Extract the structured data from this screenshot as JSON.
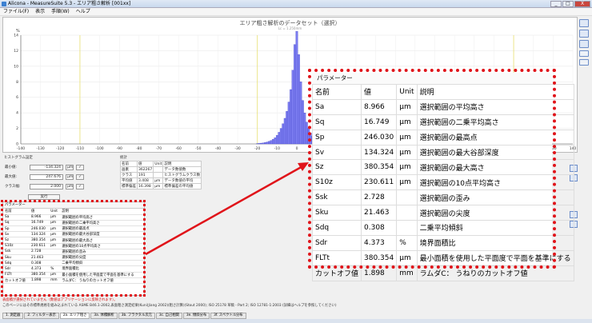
{
  "window": {
    "title": "Alicona - MeasureSuite 5.3 - エリア粗さ解析 [001xx]",
    "controls": [
      "_",
      "□",
      "X"
    ]
  },
  "menu": [
    "ファイル(F)",
    "表示",
    "手順(W)",
    "ヘルプ"
  ],
  "chart": {
    "title": "エリア粗さ解析のデータセット（選択）",
    "subtitle": "Lc = 1.250mm",
    "yunit": "%"
  },
  "chart_data": {
    "type": "bar",
    "title": "エリア粗さ解析のデータセット（選択）",
    "xlim": [
      -140,
      140
    ],
    "ylim": [
      0,
      14
    ],
    "xticks": [
      -140,
      -130,
      -120,
      -110,
      -100,
      -90,
      -80,
      -70,
      -60,
      -50,
      -40,
      -30,
      -20,
      -10,
      0,
      10,
      20,
      30,
      40,
      50,
      60,
      70,
      80,
      90,
      100,
      110,
      120,
      130,
      140
    ],
    "yticks": [
      0,
      2,
      4,
      6,
      8,
      10,
      12,
      14
    ],
    "bin_width": 1,
    "bins_x": [
      -20,
      -19,
      -18,
      -17,
      -16,
      -15,
      -14,
      -13,
      -12,
      -11,
      -10,
      -9,
      -8,
      -7,
      -6,
      -5,
      -4,
      -3,
      -2,
      -1,
      0,
      1,
      2,
      3,
      4,
      5,
      6,
      7,
      8,
      9,
      10,
      11,
      12,
      13,
      14,
      15,
      16,
      17,
      18,
      19,
      20
    ],
    "values": [
      0.05,
      0.07,
      0.1,
      0.13,
      0.18,
      0.25,
      0.33,
      0.45,
      0.6,
      0.8,
      1.1,
      1.5,
      2.0,
      2.6,
      3.3,
      4.2,
      5.4,
      7.0,
      9.5,
      12.8,
      14.5,
      11.5,
      8.0,
      5.6,
      4.0,
      2.8,
      2.0,
      1.4,
      1.0,
      0.7,
      0.5,
      0.36,
      0.26,
      0.19,
      0.14,
      0.1,
      0.08,
      0.06,
      0.05,
      0.04,
      0.03
    ],
    "vertical_markers": [
      -110,
      -20,
      110
    ],
    "grid": true
  },
  "histogram_settings": {
    "caption": "ヒストグラム設定",
    "rows": [
      {
        "label": "最小値:",
        "value": "-134.324",
        "unit": "µm"
      },
      {
        "label": "最大値:",
        "value": "247.676",
        "unit": "µm"
      },
      {
        "label": "クラス幅:",
        "value": "2.000",
        "unit": "µm"
      }
    ],
    "execute": "実行"
  },
  "stats": {
    "caption": "統計",
    "headers": [
      "名前",
      "値",
      "Unit",
      "説明"
    ],
    "rows": [
      [
        "画素",
        "362267",
        "",
        "データ数値数"
      ],
      [
        "クラス",
        "191",
        "",
        "ヒストグラムクラス数"
      ],
      [
        "平均値",
        "3.408",
        "µm",
        "データ数値の平均"
      ],
      [
        "標準偏差",
        "16.398",
        "µm",
        "標準偏差の平均値"
      ]
    ]
  },
  "params": {
    "caption": "パラメーター",
    "headers": [
      "名前",
      "値",
      "Unit",
      "説明"
    ],
    "rows": [
      [
        "Sa",
        "8.966",
        "µm",
        "選択範囲の平均高さ"
      ],
      [
        "Sq",
        "16.749",
        "µm",
        "選択範囲の二乗平均高さ"
      ],
      [
        "Sp",
        "246.030",
        "µm",
        "選択範囲の最高点"
      ],
      [
        "Sv",
        "134.324",
        "µm",
        "選択範囲の最大谷部深度"
      ],
      [
        "Sz",
        "380.354",
        "µm",
        "選択範囲の最大高さ"
      ],
      [
        "S10z",
        "230.611",
        "µm",
        "選択範囲の10点平均高さ"
      ],
      [
        "Ssk",
        "2.728",
        "",
        "選択範囲の歪み"
      ],
      [
        "Sku",
        "21.463",
        "",
        "選択範囲の尖度"
      ],
      [
        "Sdq",
        "0.308",
        "",
        "二乗平均傾斜"
      ],
      [
        "Sdr",
        "4.373",
        "%",
        "境界面積比"
      ],
      [
        "FLTt",
        "380.354",
        "µm",
        "最小面積を使用した平面度で平面を基準にする"
      ],
      [
        "カットオフ値",
        "1.898",
        "mm",
        "ラムダC： うねりのカットオフ値"
      ]
    ]
  },
  "notes": {
    "warning": "表面積が選択されていません（数値はアプリケーションに反映されます）。",
    "reference": "このページにはその標準規格を組み込まれている ASME B46.1-2002,表面粗さ測定結果(Kuni(Jiang 2002)(粗さ計算)(Stout 2000); ISO 25178 草稿 - Part 2; ISO 12781-1:2003 (詳細はヘルプを参照してください)"
  },
  "tabs": [
    "1. 測定器",
    "2. フィルター表示",
    "2a. エリア粗さ",
    "3a. 体積解析",
    "3b. フラクタル次元",
    "3c. 自己相関",
    "3e. 傾斜分布",
    "3f. スペクトル分布"
  ],
  "active_tab": 2,
  "colors": {
    "bar": "#7b7cf0",
    "bar_edge": "#3f41c8",
    "highlight": "#e0141a",
    "marker": "#e8e070"
  }
}
